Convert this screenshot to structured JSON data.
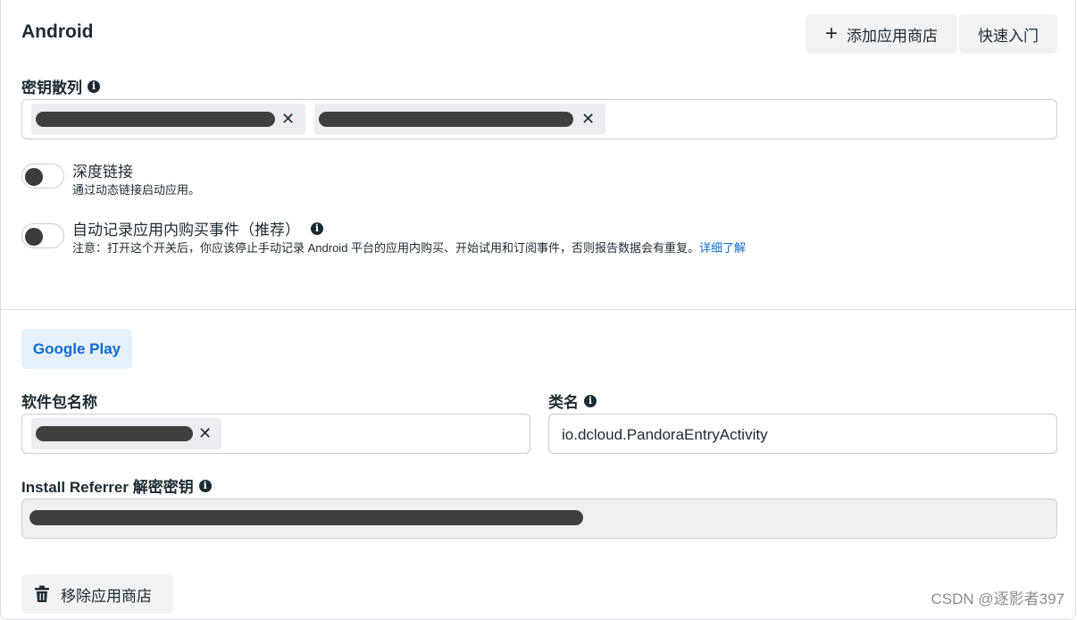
{
  "platform": {
    "title": "Android"
  },
  "toolbar": {
    "add_store_label": "添加应用商店",
    "add_plus": "+",
    "quickstart_label": "快速入门"
  },
  "key_hashes": {
    "label": "密钥散列",
    "info": "i",
    "chips": [
      {
        "value": ""
      },
      {
        "value": ""
      }
    ]
  },
  "deep_link": {
    "title": "深度链接",
    "subtitle": "通过动态链接启动应用。",
    "enabled": false
  },
  "auto_log": {
    "title": "自动记录应用内购买事件（推荐）",
    "info": "i",
    "subtitle": "注意：打开这个开关后，你应该停止手动记录 Android 平台的应用内购买、开始试用和订阅事件，否则报告数据会有重复。",
    "link": "详细了解",
    "enabled": false
  },
  "store_tab": {
    "label": "Google Play"
  },
  "package_name": {
    "label": "软件包名称",
    "chips": [
      {
        "value": ""
      }
    ]
  },
  "class_name": {
    "label": "类名",
    "info": "i",
    "value": "io.dcloud.PandoraEntryActivity"
  },
  "referrer_key": {
    "label": "Install Referrer 解密密钥",
    "info": "i",
    "value": ""
  },
  "remove_store": {
    "label": "移除应用商店"
  },
  "watermark": "CSDN @逐影者397",
  "icons": {
    "chip_remove": "close-icon",
    "trash": "trash-icon",
    "info": "info-icon"
  },
  "colors": {
    "link": "#0a6ad1",
    "tab_bg": "#e6f0fb",
    "redacted": "#3f3f3f"
  }
}
